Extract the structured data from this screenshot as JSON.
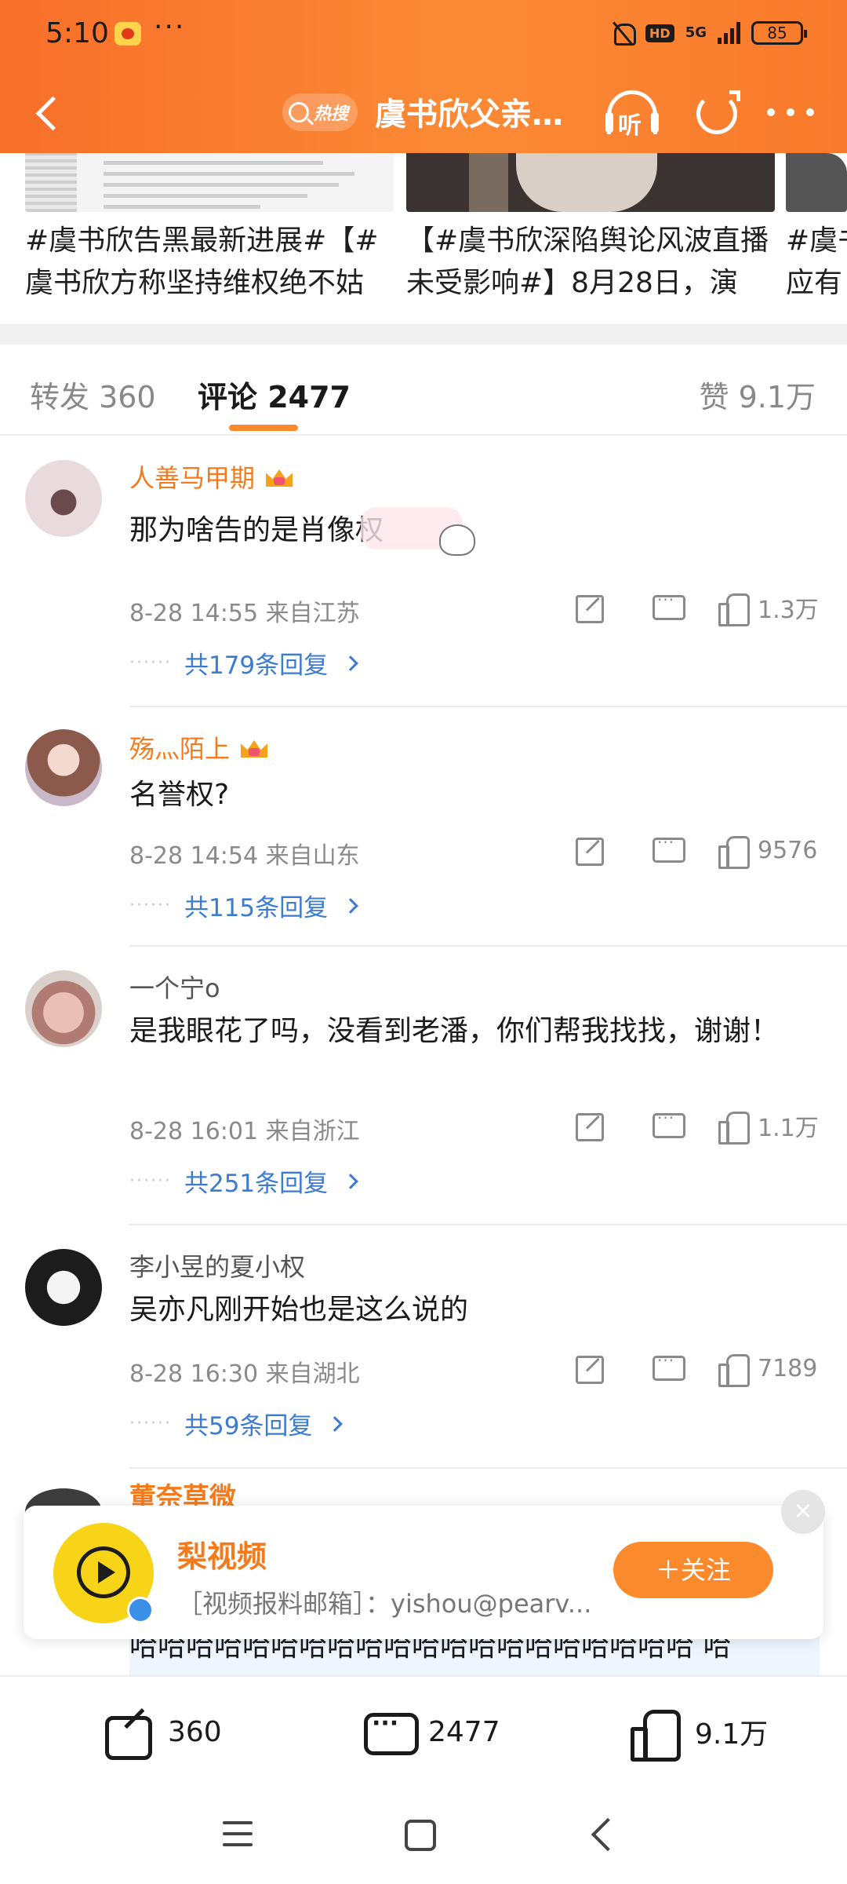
{
  "status_bar": {
    "time": "5:10",
    "more": "···",
    "hd": "HD",
    "network": "5G",
    "battery": "85"
  },
  "nav": {
    "hot_label": "热搜",
    "title": "虞书欣父亲…",
    "listen_label": "听"
  },
  "related_cards": [
    {
      "text": "#虞书欣告黑最新进展#【#虞书欣方称坚持维权绝不姑"
    },
    {
      "text": "【#虞书欣深陷舆论风波直播未受影响#】8月28日，演"
    },
    {
      "text": "#虞书应有"
    }
  ],
  "tabs": {
    "repost": "转发 360",
    "comment": "评论 2477",
    "like": "赞 9.1万"
  },
  "comments": [
    {
      "name": "人善马甲期",
      "vip": true,
      "body": "那为啥告的是肖像权",
      "time_location": "8-28 14:55  来自江苏",
      "likes": "1.3万",
      "replies": "共179条回复"
    },
    {
      "name": "殇灬陌上",
      "vip": true,
      "body": "名誉权?",
      "time_location": "8-28 14:54  来自山东",
      "likes": "9576",
      "replies": "共115条回复"
    },
    {
      "name": "一个宁o",
      "vip": false,
      "body": "是我眼花了吗，没看到老潘，你们帮我找找，谢谢！",
      "time_location": "8-28 16:01  来自浙江",
      "likes": "1.1万",
      "replies": "共251条回复"
    },
    {
      "name": "李小昱的夏小权",
      "vip": false,
      "body": "吴亦凡刚开始也是这么说的",
      "time_location": "8-28 16:30  来自湖北",
      "likes": "7189",
      "replies": "共59条回复"
    }
  ],
  "peek": {
    "name": "董奈草微",
    "text": "哈哈哈哈哈哈哈哈哈哈哈哈哈哈哈哈哈哈哈哈 哈"
  },
  "ad": {
    "name": "梨视频",
    "desc": "［视频报料邮箱］：yishou@pearv...",
    "follow": "＋关注",
    "close": "×"
  },
  "bottom_bar": {
    "repost_count": "360",
    "comment_count": "2477",
    "like_count": "9.1万"
  }
}
